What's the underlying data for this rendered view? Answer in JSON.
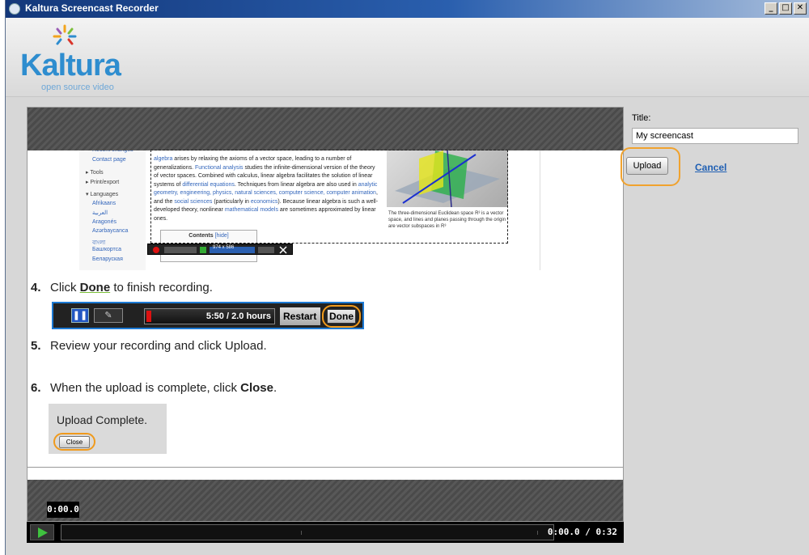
{
  "window": {
    "title": "Kaltura Screencast Recorder",
    "minimize": "_",
    "maximize": "□",
    "close": "✕"
  },
  "logo": {
    "wordmark": "Kaltura",
    "tagline": "open source video"
  },
  "tutorial": {
    "wiki": {
      "nav_items": [
        "Recent changes",
        "Contact page",
        "▸ Tools",
        "▸ Print/export",
        "▾ Languages",
        "Afrikaans",
        "العربية",
        "Aragonés",
        "Azərbaycanca",
        "বাংলা",
        "Башҡортса",
        "Беларуская"
      ],
      "paragraph": [
        {
          "text": "algebra",
          "link": true
        },
        {
          "text": " arises by relaxing the axioms of a vector space, leading to a number of generalizations. ",
          "link": false
        },
        {
          "text": "Functional analysis",
          "link": true
        },
        {
          "text": " studies the infinite-dimensional version of the theory of vector spaces. Combined with calculus, linear algebra facilitates the solution of linear systems of ",
          "link": false
        },
        {
          "text": "differential equations",
          "link": true
        },
        {
          "text": ". Techniques from linear algebra are also used in ",
          "link": false
        },
        {
          "text": "analytic geometry, engineering, physics, natural sciences, computer science, computer animation",
          "link": true
        },
        {
          "text": ", and the ",
          "link": false
        },
        {
          "text": "social sciences",
          "link": true
        },
        {
          "text": " (particularly in ",
          "link": false
        },
        {
          "text": "economics",
          "link": true
        },
        {
          "text": "). Because linear algebra is such a well-developed theory, nonlinear ",
          "link": false
        },
        {
          "text": "mathematical models",
          "link": true
        },
        {
          "text": " are sometimes approximated by linear ones.",
          "link": false
        }
      ],
      "figure_caption": "The three-dimensional Euclidean space R³ is a vector space, and lines and planes passing through the origin are vector subspaces in R³",
      "toc_title": "Contents",
      "toc_hide": "[hide]",
      "toolbar_size": "974 x 586"
    },
    "step4": {
      "num": "4.",
      "before": "Click ",
      "bold": "Done",
      "after": " to finish recording."
    },
    "recorder_bar": {
      "time": "5:50 / 2.0 hours",
      "restart": "Restart",
      "done": "Done"
    },
    "step5": {
      "num": "5.",
      "text": "Review your recording and click Upload."
    },
    "step6": {
      "num": "6.",
      "before": "When the upload is complete, click ",
      "bold": "Close",
      "after": "."
    },
    "upload_complete": {
      "heading": "Upload Complete.",
      "close": "Close"
    }
  },
  "player": {
    "current_time": "0:00.0",
    "duration_display": "0:00.0 / 0:32"
  },
  "side_panel": {
    "title_label": "Title:",
    "title_value": "My screencast",
    "upload": "Upload",
    "cancel": "Cancel"
  }
}
